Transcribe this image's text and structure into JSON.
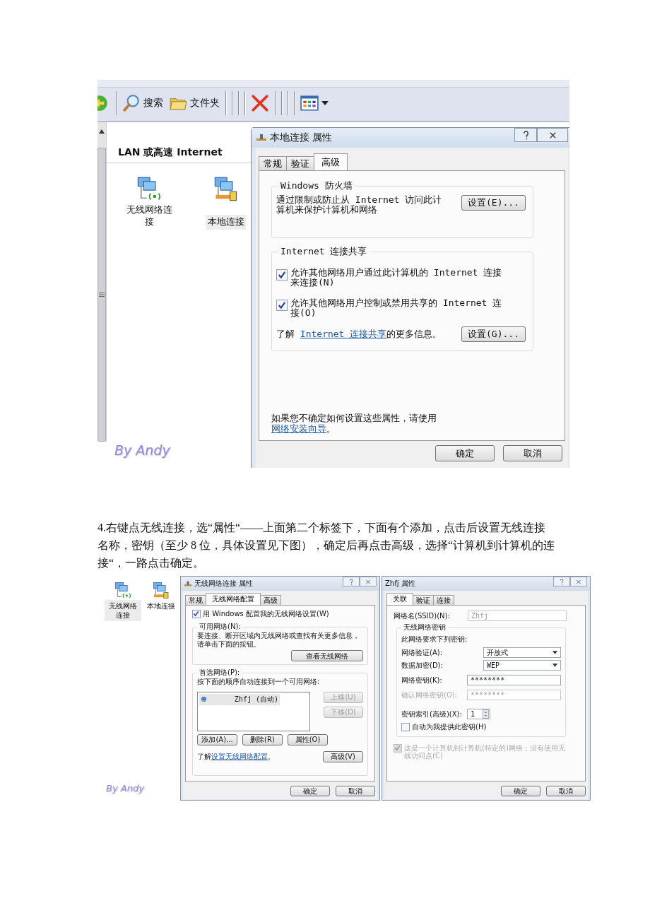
{
  "figure_1": {
    "toolbar": [
      {
        "kind": "back"
      },
      {
        "kind": "search",
        "label": "搜索"
      },
      {
        "kind": "folders",
        "label": "文件夹"
      },
      {
        "kind": "delete"
      },
      {
        "kind": "views"
      }
    ],
    "explorer": {
      "group_header": "LAN 或高速 Internet",
      "items": [
        {
          "kind": "wireless",
          "label": "无线网络连接",
          "selected": false
        },
        {
          "kind": "lan",
          "label": "本地连接",
          "selected": true
        }
      ]
    },
    "signature": "By Andy",
    "dialog": {
      "title": "本地连接 属性",
      "tabs": [
        {
          "label": "常规",
          "selected": false
        },
        {
          "label": "验证",
          "selected": false
        },
        {
          "label": "高级",
          "selected": true
        }
      ],
      "firewall_group": {
        "title": "Windows 防火墙",
        "text": "通过限制或防止从 Internet 访问此计算机来保护计算机和网络",
        "button": "设置(E)..."
      },
      "sharing_group": {
        "title": "Internet 连接共享",
        "checkboxes": [
          {
            "label": "允许其他网络用户通过此计算机的 Internet 连接来连接(N)",
            "checked": true
          },
          {
            "label": "允许其他网络用户控制或禁用共享的 Internet 连接(O)",
            "checked": true
          }
        ],
        "info_prefix": "了解 ",
        "info_link": "Internet 连接共享",
        "info_suffix": "的更多信息。",
        "button": "设置(G)..."
      },
      "hint_text": "如果您不确定如何设置这些属性，请使用",
      "hint_link": "网络安装向导",
      "hint_suffix": "。",
      "buttons": [
        "确定",
        "取消"
      ]
    }
  },
  "paragraph": "4.右键点无线连接，选“属性“——上面第二个标签下，下面有个添加，点击后设置无线连接名称，密钥（至少 8 位，具体设置见下图），确定后再点击高级，选择“计算机到计算机的连接“，一路点击确定。",
  "figure_2": {
    "explorer": {
      "items": [
        {
          "kind": "wireless",
          "label": "无线网络连接",
          "selected": true
        },
        {
          "kind": "lan",
          "label": "本地连接",
          "selected": false
        }
      ]
    },
    "signature": "By Andy",
    "wireless_dialog": {
      "title": "无线网络连接 属性",
      "tabs": [
        {
          "label": "常规",
          "selected": false
        },
        {
          "label": "无线网络配置",
          "selected": true
        },
        {
          "label": "高级",
          "selected": false
        }
      ],
      "use_windows": {
        "label": "用 Windows 配置我的无线网络设置(W)",
        "checked": true
      },
      "available_group": {
        "title": "可用网络(N):",
        "text": "要连接、断开区域内无线网络或查找有关更多信息，请单击下面的按钮。",
        "button": "查看无线网络"
      },
      "preferred_group": {
        "title": "首选网络(P):",
        "text": "按下面的顺序自动连接到一个可用网络:",
        "networks": [
          {
            "label": "Zhfj (自动)",
            "selected": true
          }
        ],
        "move_buttons": [
          {
            "label": "上移(U)",
            "disabled": true
          },
          {
            "label": "下移(D)",
            "disabled": true
          }
        ],
        "action_buttons": [
          {
            "label": "添加(A)...",
            "disabled": false
          },
          {
            "label": "删除(R)",
            "disabled": false
          },
          {
            "label": "属性(O)",
            "disabled": false
          }
        ],
        "info_prefix": "了解",
        "info_link": "设置无线网络配置",
        "info_suffix": "。",
        "advanced_button": "高级(V)"
      },
      "buttons": [
        "确定",
        "取消"
      ]
    },
    "network_dialog": {
      "title": "Zhfj 属性",
      "tabs": [
        {
          "label": "关联",
          "selected": true
        },
        {
          "label": "验证",
          "selected": false
        },
        {
          "label": "连接",
          "selected": false
        }
      ],
      "ssid": {
        "label": "网络名(SSID)(N):",
        "value": "Zhfj",
        "disabled": true
      },
      "key_group": {
        "title": "无线网络密钥",
        "text": "此网络要求下列密钥:",
        "fields": [
          {
            "kind": "select",
            "label": "网络验证(A):",
            "value": "开放式",
            "disabled": false
          },
          {
            "kind": "select",
            "label": "数据加密(D):",
            "value": "WEP",
            "disabled": false
          },
          {
            "kind": "text",
            "label": "网络密钥(K):",
            "value": "********",
            "disabled": false
          },
          {
            "kind": "text",
            "label": "确认网络密钥(O):",
            "value": "********",
            "disabled": true
          },
          {
            "kind": "spin",
            "label": "密钥索引(高级)(X):",
            "value": "1",
            "disabled": false
          }
        ],
        "auto_key": {
          "label": "自动为我提供此密钥(H)",
          "checked": false
        }
      },
      "adhoc": {
        "label": "这是一个计算机到计算机(特定的)网络；没有使用无线访问点(C)",
        "checked": true,
        "disabled": true
      },
      "buttons": [
        "确定",
        "取消"
      ]
    }
  }
}
